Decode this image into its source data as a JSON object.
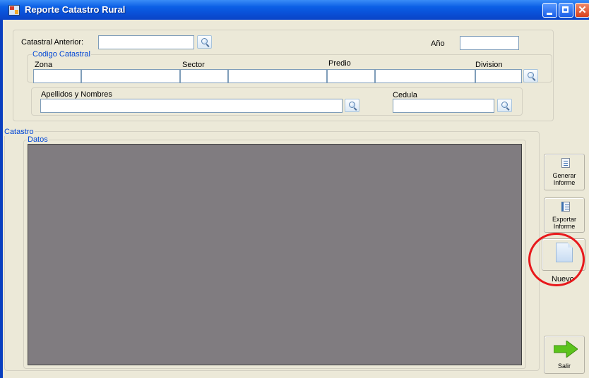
{
  "window": {
    "title": "Reporte Catastro Rural"
  },
  "search": {
    "catastral_anterior_label": "Catastral Anterior:",
    "catastral_anterior_value": "",
    "anio_label": "Año",
    "anio_value": ""
  },
  "codigo_catastral": {
    "legend": "Codigo Catastral",
    "zona_label": "Zona",
    "sector_label": "Sector",
    "predio_label": "Predio",
    "division_label": "Division"
  },
  "persona": {
    "apellidos_label": "Apellidos y Nombres",
    "apellidos_value": "",
    "cedula_label": "Cedula",
    "cedula_value": ""
  },
  "catastro": {
    "legend": "Catastro",
    "datos_legend": "Datos"
  },
  "actions": {
    "generar_line1": "Generar",
    "generar_line2": "Informe",
    "exportar_line1": "Exportar",
    "exportar_line2": "Informe",
    "nuevo": "Nuevo",
    "salir": "Salir"
  },
  "colors": {
    "title_bar": "#0a4fd6",
    "form_bg": "#ece9d8",
    "group_legend": "#0046d5",
    "grid_bg": "#807c80",
    "highlight_circle": "#e8191c",
    "exit_arrow": "#5cc31c"
  },
  "icons": {
    "app": "app-icon",
    "minimize": "minimize-icon",
    "maximize": "maximize-icon",
    "close": "close-icon",
    "search": "search-icon",
    "generar": "report-icon",
    "exportar": "export-icon",
    "nuevo": "new-document-icon",
    "salir": "exit-arrow-icon"
  }
}
